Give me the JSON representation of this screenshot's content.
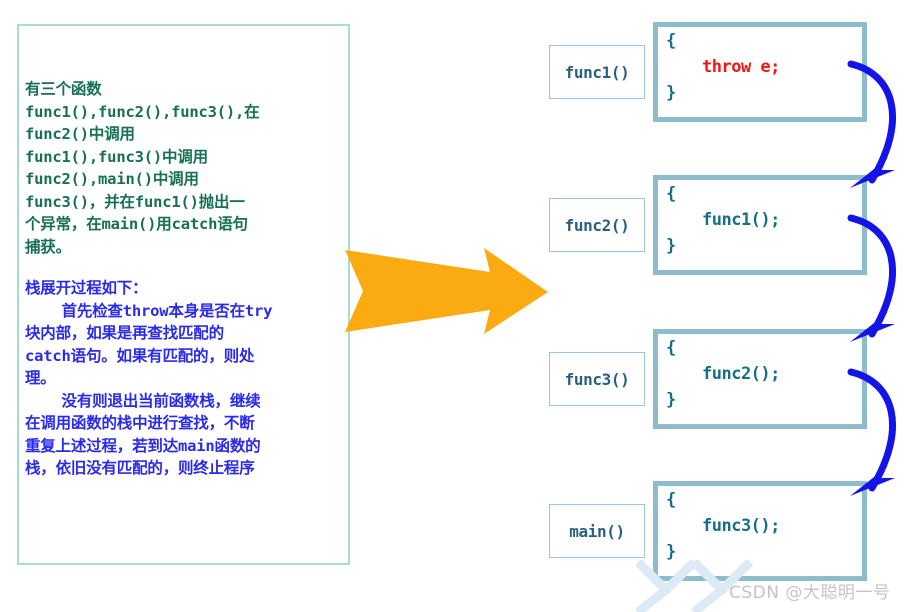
{
  "description_panel": {
    "paragraph_intro": "有三个函数\nfunc1(),func2(),func3(),在\nfunc2()中调用\nfunc1(),func3()中调用\nfunc2(),main()中调用\nfunc3()，并在func1()抛出一\n个异常，在main()用catch语句\n捕获。",
    "paragraph_unwind": "栈展开过程如下：\n    首先检查throw本身是否在try\n块内部，如果是再查找匹配的\ncatch语句。如果有匹配的，则处\n理。\n    没有则退出当前函数栈，继续\n在调用函数的栈中进行查找，不断\n重复上述过程，若到达main函数的\n栈，依旧没有匹配的，则终止程序",
    "border_color": "#a9ddd1",
    "intro_color": "#177055",
    "unwind_color": "#2a2aef"
  },
  "flow_arrow": {
    "name": "orange-right-arrow",
    "color": "#fbab12"
  },
  "call_stack": {
    "frames": [
      {
        "label": "func1()",
        "brace_open": "{",
        "statement": "throw e;",
        "brace_close": "}",
        "statement_color": "#f21616"
      },
      {
        "label": "func2()",
        "brace_open": "{",
        "statement": "func1();",
        "brace_close": "}",
        "statement_color": "#176e86"
      },
      {
        "label": "func3()",
        "brace_open": "{",
        "statement": "func2();",
        "brace_close": "}",
        "statement_color": "#176e86"
      },
      {
        "label": "main()",
        "brace_open": "{",
        "statement": "func3();",
        "brace_close": "}",
        "statement_color": "#176e86"
      }
    ],
    "label_border_color": "#9cc3e8",
    "code_border_color": "#8fbccd",
    "code_text_color": "#176e86",
    "unwind_arrow_color": "#1414e8",
    "unwind_arrow_count": 3
  },
  "watermark": {
    "text": "CSDN @大聪明一号",
    "color": "#c4c4c4"
  }
}
